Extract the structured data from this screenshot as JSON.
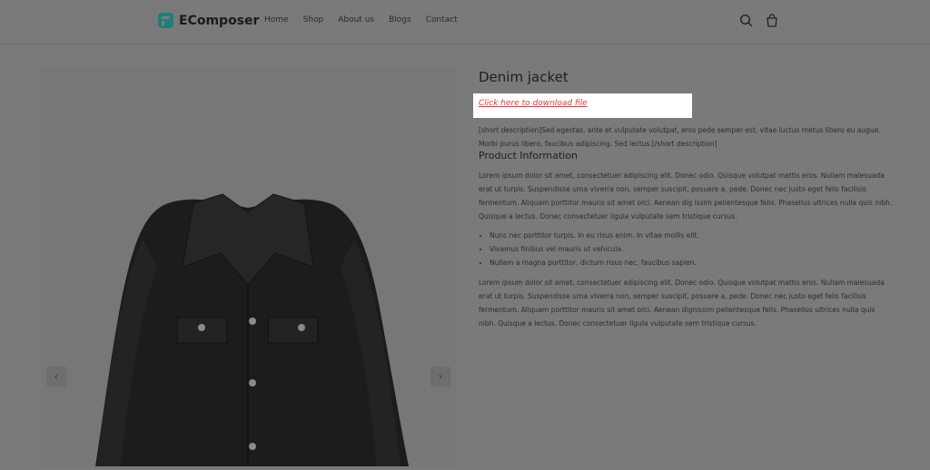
{
  "header": {
    "brand": "EComposer",
    "nav": [
      "Home",
      "Shop",
      "About us",
      "Blogs",
      "Contact"
    ],
    "icons": [
      "search-icon",
      "cart-icon"
    ]
  },
  "product": {
    "title": "Denim jacket",
    "download_link": "Click here to download file",
    "short_description": "[short description]Sed egestas, ante et vulputate volutpat, eros pede semper est, vitae luctus metus libero eu augue. Morbi purus libero, faucibus adipiscing. Sed lectus.[/short description]",
    "section_title": "Product Information",
    "paragraph1": "Lorem ipsum dolor sit amet, consectetuer adipiscing elit. Donec odio. Quisque volutpat mattis eros. Nullam malesuada erat ut turpis. Suspendisse urna viverra non, semper suscipit, posuere a, pede. Donec nec justo eget felis facilisis fermentum. Aliquam porttitor mauris sit amet orci. Aenean dig issim pellentesque felis. Phasellus ultrices nulla quis nibh. Quisque a lectus. Donec consectetuer ligula vulputate sem tristique cursus.",
    "bullets": [
      "Nunc nec porttitor turpis. In eu risus enim. In vitae mollis elit.",
      "Vivamus finibus vel mauris ut vehicula.",
      "Nullam a magna porttitor, dictum risus nec, faucibus sapien."
    ],
    "paragraph2": "Lorem ipsum dolor sit amet, consectetuer adipiscing elit. Donec odio. Quisque volutpat mattis eros. Nullam malesuada erat ut turpis. Suspendisse urna viverra non, semper suscipit, posuere a, pede. Donec nec justo eget felis facilisis fermentum. Aliquam porttitor mauris sit amet orci. Aenean dignissim pellentesque felis. Phasellus ultrices nulla quis nibh. Quisque a lectus. Donec consectetuer ligula vulputate sem tristique cursus."
  },
  "gallery": {
    "image": "denim-jacket-image",
    "prev_icon": "chevron-left-icon",
    "next_icon": "chevron-right-icon",
    "prev_glyph": "‹",
    "next_glyph": "›"
  },
  "colors": {
    "overlay": "#7a7a7a",
    "link": "#e8353b",
    "brand": "#1f7f7b"
  }
}
